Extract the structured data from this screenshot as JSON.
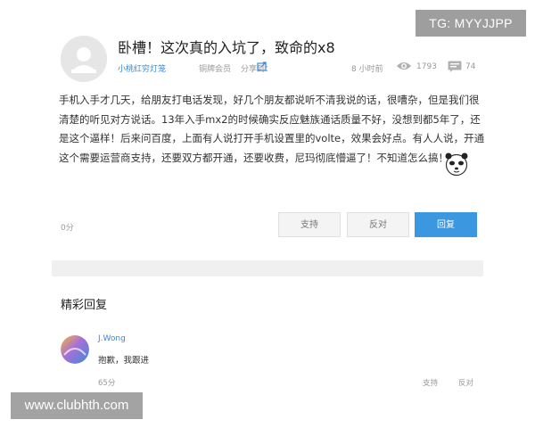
{
  "watermarks": {
    "top_right": "TG: MYYJJPP",
    "bottom_left": "www.clubhth.com"
  },
  "post": {
    "title": "卧槽！这次真的入坑了，致命的x8",
    "author": "小桃红穷灯笼",
    "rank": "铜牌会员",
    "share_label": "分享到：",
    "time": "8 小时前",
    "views": "1793",
    "comments": "74",
    "body_lines": [
      "手机入手才几天，给朋友打电话发现，好几个朋友都说听不清我说的话，很嘈杂，但是我们很",
      "清楚的听见对方说话。13年入手mx2的时候确实反应魅族通话质量不好，没想到都5年了，还",
      "是这个逼样！后来问百度，上面有人说打开手机设置里的volte，效果会好点。有人人说，开通",
      "这个需要运营商支持，还要双方都开通，还要收费，尼玛彻底懵逼了！不知道怎么搞！"
    ],
    "score": "0分",
    "buttons": {
      "support": "支持",
      "oppose": "反对",
      "reply": "回复"
    }
  },
  "replies": {
    "title": "精彩回复",
    "items": [
      {
        "name": "J.Wong",
        "text": "抱歉，我跟进",
        "score": "65分",
        "support": "支持",
        "oppose": "反对"
      }
    ]
  },
  "colors": {
    "accent_blue": "#3b98e0",
    "link_blue": "#3b8bd4",
    "muted": "#999999"
  }
}
